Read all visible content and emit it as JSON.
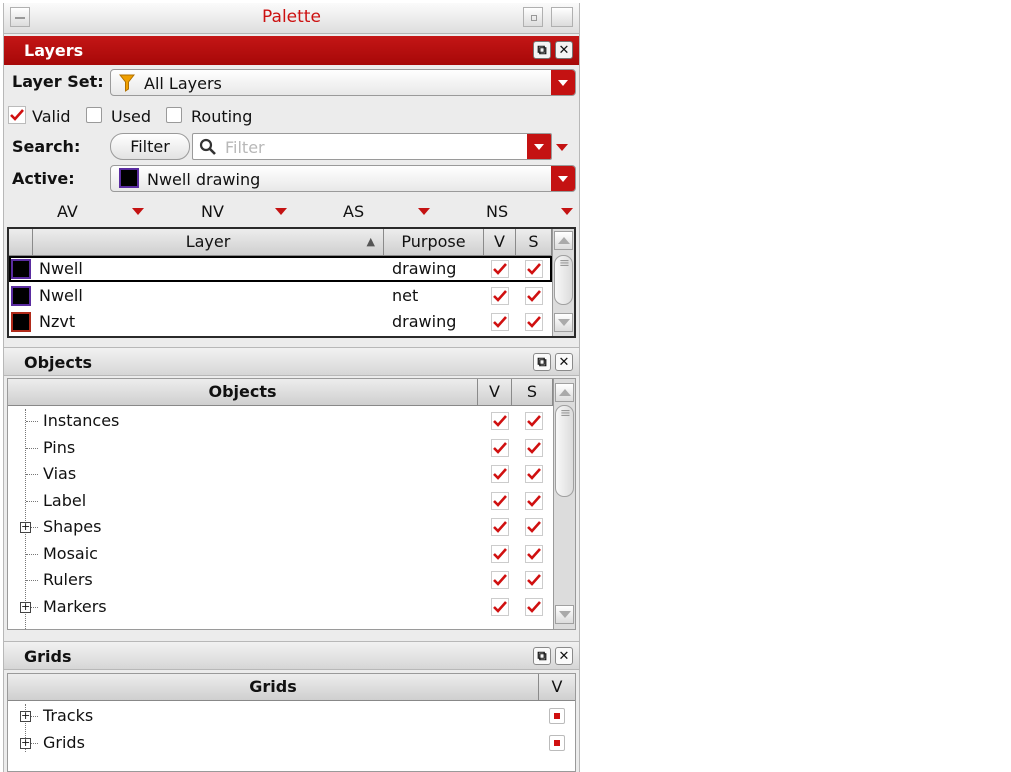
{
  "window": {
    "title": "Palette"
  },
  "layers": {
    "header": "Layers",
    "layer_set_label": "Layer Set:",
    "layer_set_value": "All Layers",
    "filters": [
      {
        "label": "Valid",
        "checked": true
      },
      {
        "label": "Used",
        "checked": false
      },
      {
        "label": "Routing",
        "checked": false
      }
    ],
    "search_label": "Search:",
    "filter_button": "Filter",
    "search_placeholder": "Filter",
    "active_label": "Active:",
    "active_value": "Nwell drawing",
    "toggles": [
      "AV",
      "NV",
      "AS",
      "NS"
    ],
    "columns": {
      "layer": "Layer",
      "purpose": "Purpose",
      "v": "V",
      "s": "S"
    },
    "rows": [
      {
        "layer": "Nwell",
        "purpose": "drawing",
        "color": "#5a2ca0",
        "v": true,
        "s": true
      },
      {
        "layer": "Nwell",
        "purpose": "net",
        "color": "#5a2ca0",
        "v": true,
        "s": true
      },
      {
        "layer": "Nzvt",
        "purpose": "drawing",
        "color": "#b02a1a",
        "v": true,
        "s": true
      }
    ]
  },
  "objects": {
    "header": "Objects",
    "columns": {
      "objects": "Objects",
      "v": "V",
      "s": "S"
    },
    "rows": [
      {
        "label": "Instances",
        "expandable": false
      },
      {
        "label": "Pins",
        "expandable": false
      },
      {
        "label": "Vias",
        "expandable": false
      },
      {
        "label": "Label",
        "expandable": false
      },
      {
        "label": "Shapes",
        "expandable": true
      },
      {
        "label": "Mosaic",
        "expandable": false
      },
      {
        "label": "Rulers",
        "expandable": false
      },
      {
        "label": "Markers",
        "expandable": true
      }
    ]
  },
  "grids": {
    "header": "Grids",
    "columns": {
      "grids": "Grids",
      "v": "V"
    },
    "rows": [
      {
        "label": "Tracks",
        "expandable": true
      },
      {
        "label": "Grids",
        "expandable": true
      }
    ]
  },
  "colors": {
    "accent": "#c41212",
    "check": "#d01010"
  }
}
